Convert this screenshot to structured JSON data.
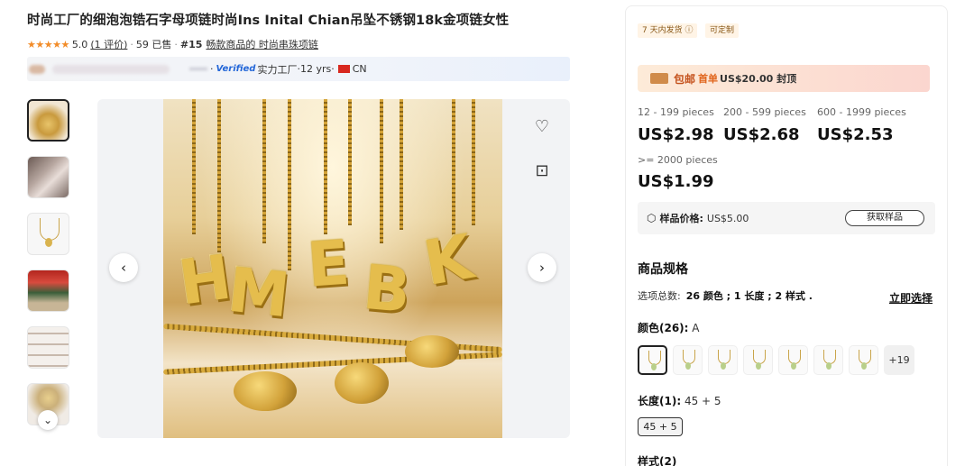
{
  "product": {
    "title": "时尚工厂的细泡泡锆石字母项链时尚Ins Inital Chian吊坠不锈钢18k金项链女性",
    "rating_stars": "★★★★★",
    "rating": "5.0",
    "reviews": "(1 评价)",
    "sold": "59 已售",
    "rank_prefix": "#15",
    "rank_text": "畅款商品的 时尚串珠项链"
  },
  "supplier": {
    "verified": "Verified",
    "type": "实力工厂",
    "years": "12 yrs",
    "country": "CN"
  },
  "gallery": {
    "letters": [
      "H",
      "M",
      "E",
      "B",
      "K"
    ],
    "prev_icon": "‹",
    "next_icon": "›",
    "fav_icon": "♡",
    "scan_icon": "⊡",
    "thumbs_down_icon": "⌄"
  },
  "panel": {
    "badges": [
      "7 天内发货 ⓘ",
      "可定制"
    ],
    "promo": {
      "mail": "包邮",
      "highlight": "首单",
      "rest": "US$20.00 封顶"
    },
    "tiers": [
      {
        "range": "12 - 199 pieces",
        "price": "US$2.98"
      },
      {
        "range": "200 - 599 pieces",
        "price": "US$2.68"
      },
      {
        "range": "600 - 1999 pieces",
        "price": "US$2.53"
      },
      {
        "range": ">= 2000 pieces",
        "price": "US$1.99"
      }
    ],
    "sample": {
      "icon": "⬡",
      "label": "样品价格:",
      "value": "US$5.00",
      "button": "获取样品"
    },
    "specs": {
      "title": "商品规格",
      "options_label": "选项总数:",
      "options_value": "26 颜色 ; 1 长度 ; 2 样式 .",
      "select_now": "立即选择",
      "color_label": "颜色(26):",
      "color_value": "A",
      "more_colors": "+19",
      "length_label": "长度(1):",
      "length_value": "45 + 5",
      "length_chip": "45 + 5",
      "style_label": "样式(2)"
    }
  }
}
